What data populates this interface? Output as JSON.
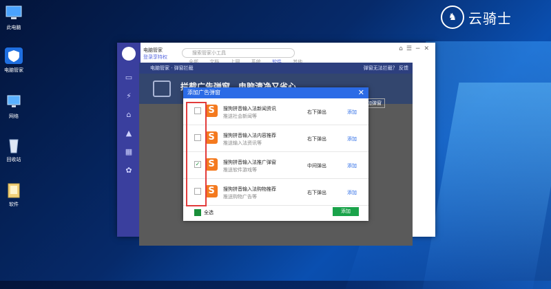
{
  "desktop": {
    "icons": [
      {
        "label": "此电脑",
        "icon": "computer-icon"
      },
      {
        "label": "电脑管家",
        "icon": "shield-icon"
      },
      {
        "label": "网络",
        "icon": "network-icon"
      },
      {
        "label": "回收站",
        "icon": "recycle-bin-icon"
      },
      {
        "label": "软件",
        "icon": "folder-icon"
      }
    ]
  },
  "brand": {
    "text": "云骑士"
  },
  "app": {
    "title": "电脑管家",
    "subtitle": "登录享特权",
    "search_placeholder": "搜索管家小工具",
    "tabs": [
      "全部",
      "文档",
      "上网",
      "系统",
      "软件",
      "其他"
    ]
  },
  "popup_manager": {
    "title": "电脑管家 · 弹窗拦截",
    "right_text": "弹窗无法拦截？ 反馈",
    "hero_text": "拦截广告弹窗，电脑清净又省心",
    "hero_btn": "添加弹窗"
  },
  "dialog": {
    "title": "添加广告弹窗",
    "rows": [
      {
        "name": "搜狗拼音输入法新闻资讯",
        "desc": "推送社会新闻等",
        "type": "右下弹出",
        "action": "添加",
        "checked": false
      },
      {
        "name": "搜狗拼音输入法内容推荐",
        "desc": "推送输入法资讯等",
        "type": "右下弹出",
        "action": "添加",
        "checked": false
      },
      {
        "name": "搜狗拼音输入法推广弹窗",
        "desc": "推送软件游戏等",
        "type": "中间弹出",
        "action": "添加",
        "checked": true
      },
      {
        "name": "搜狗拼音输入法购物推荐",
        "desc": "推送购物广告等",
        "type": "右下弹出",
        "action": "添加",
        "checked": false
      }
    ],
    "select_all": "全选",
    "add_button": "添加"
  },
  "colors": {
    "accent": "#2b6be6",
    "green": "#1aa34a",
    "highlight": "#e23b3b"
  }
}
